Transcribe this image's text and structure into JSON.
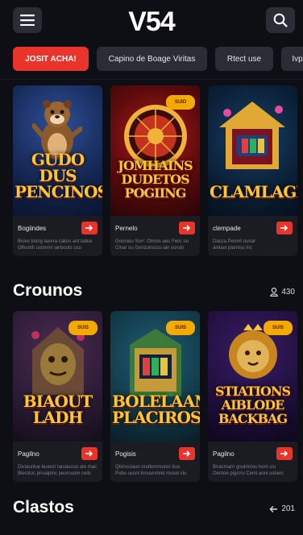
{
  "header": {
    "logo": "V54",
    "menu_icon": "hamburger-icon",
    "search_icon": "search-icon"
  },
  "chips": [
    {
      "label": "JOSIT ACHA!",
      "active": true
    },
    {
      "label": "Capino de Boage Viritas",
      "active": false
    },
    {
      "label": "Rtect use",
      "active": false
    },
    {
      "label": "Ivp",
      "active": false
    }
  ],
  "row1": {
    "cards": [
      {
        "art_title": "GUDO DUS PENCINOS",
        "name": "Bogiindes",
        "desc": [
          "Bicke boing laevra cakus ant ladue",
          "Olhunth ustnnmi ianbcuts ocu"
        ],
        "badge": ""
      },
      {
        "art_title": "JOMHAINS DUDETOS POGIING",
        "name": "Pernelo",
        "desc": [
          "Gonnieu Sorr: Otmos aeu Feiic ou",
          "Cinar ou Gonzonscus ian scruto"
        ],
        "badge": "SUID"
      },
      {
        "art_title": "CLAMLAGH",
        "name": "clempade",
        "desc": [
          "Dacca Penmt ounar",
          "ainlaoi piamisu lnc"
        ],
        "badge": ""
      }
    ]
  },
  "section_casinos": {
    "title": "Crounos",
    "count": "430",
    "icon": "user-icon"
  },
  "row2": {
    "cards": [
      {
        "art_title": "BIAOUT LADH",
        "name": "Pagilno",
        "desc": [
          "Diviaunlue leuecn tanaiucuo ate mac",
          "Bierotuc pnsaipinc peorsuom ceilc"
        ],
        "badge": "SUIS"
      },
      {
        "art_title": "BOLELAAN PLACIROS",
        "name": "Pogisis",
        "desc": [
          "Qhrivcoaun oratlemmunoi ituo",
          "Pobu uconi lnnuunmnd mosei ciu"
        ],
        "badge": "SUIS"
      },
      {
        "art_title": "STIATIONS AIBLODE BACKBAG",
        "name": "Pagilno",
        "desc": [
          "Bnacmarn gnulmriou hem ciu",
          "Oentoe pigcrru Cemi aoni soluen"
        ],
        "badge": "SUIS"
      }
    ]
  },
  "section_classics": {
    "title": "Clastos",
    "count": "201",
    "icon": "arrow-left-icon"
  },
  "colors": {
    "accent": "#e8342b",
    "badge": "#f3a900",
    "background": "#0d0f14",
    "card": "#1a1c22"
  }
}
